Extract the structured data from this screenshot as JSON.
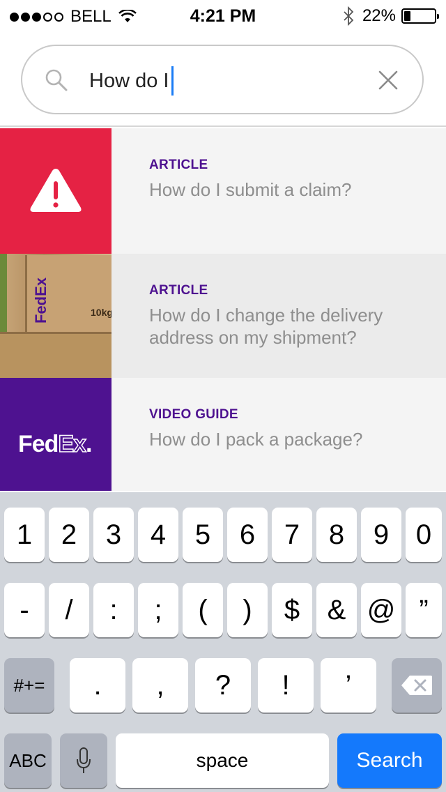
{
  "status_bar": {
    "carrier": "BELL",
    "time": "4:21 PM",
    "battery": "22%",
    "battery_level": 0.22,
    "signal_strength": 3
  },
  "search": {
    "query": "How do I",
    "icon": "search-icon",
    "clear_icon": "close-icon"
  },
  "results": [
    {
      "kind": "ARTICLE",
      "title": "How do I submit a claim?",
      "thumb": "warning-icon",
      "color": "#e52244"
    },
    {
      "kind": "ARTICLE",
      "title": "How do I change the delivery address on my shipment?",
      "thumb": "fedex-boxes-photo"
    },
    {
      "kind": "VIDEO GUIDE",
      "title": "How do I pack a package?",
      "thumb": "fedex-logo",
      "color": "#4e1290"
    }
  ],
  "fedex_logo": {
    "fed": "Fed",
    "ex": "Ex",
    "dot": "."
  },
  "photo_label": {
    "logo": "FedEx",
    "weight": "10kg"
  },
  "keyboard": {
    "row1": [
      "1",
      "2",
      "3",
      "4",
      "5",
      "6",
      "7",
      "8",
      "9",
      "0"
    ],
    "row2": [
      "-",
      "/",
      ":",
      ";",
      "(",
      ")",
      "$",
      "&",
      "@",
      "”"
    ],
    "row3": {
      "shift": "#+=",
      "keys": [
        ".",
        ",",
        "?",
        "!",
        "’"
      ],
      "delete_icon": "backspace-icon"
    },
    "row4": {
      "abc": "ABC",
      "mic_icon": "microphone-icon",
      "space": "space",
      "search": "Search"
    }
  },
  "colors": {
    "accent_blue": "#1479fc",
    "fedex_purple": "#4e1290",
    "alert_red": "#e52244"
  }
}
